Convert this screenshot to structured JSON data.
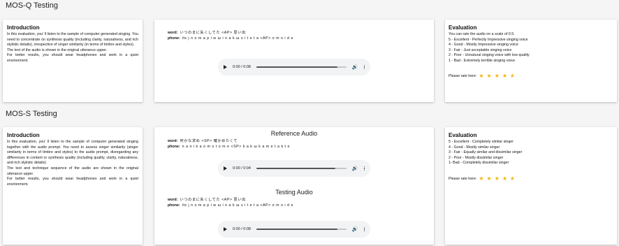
{
  "q": {
    "title": "MOS-Q Testing",
    "intro": {
      "heading": "Introduction",
      "lines": [
        "In this evaluation, you' ll listen to the sample of computer generated singing. You need to concentrate on synthesis quality (including clarity, naturalness, and rich stylistic details), irrespective of singer similarity (in terms of timbre and styles).",
        "The text of the audio is shown in the original utterance upper.",
        "For better results, you should wear headphones and work in a quiet environment."
      ]
    },
    "sample": {
      "word_label": "word:",
      "word": "いつのまに失くしてた <AP> 思い出",
      "phone_label": "phone:",
      "phone": "its i̥ n o m a p i w ɯ i n a k ɯ s i t e t a <AP> o m o i d e",
      "player": {
        "time": "0:00 / 0:08",
        "progress": 0.9
      }
    },
    "eval": {
      "heading": "Evaluation",
      "lines": [
        "You can rate the audio on a scale of 0.5.",
        "5 - Excellent - Perfectly Impressive singing voice",
        "4 - Good - Mostly Impressive singing voice",
        "3 - Fair - Just acceptable singing voice",
        "2 - Poor - Unnatural singing voice with low quality",
        "1 - Bad - Extremely terrible singing voice"
      ],
      "rate_label": "Please rate here:",
      "rating": 4.5
    }
  },
  "s": {
    "title": "MOS-S Testing",
    "intro": {
      "heading": "Introduction",
      "lines": [
        "In this evaluation, you' ll listen to the sample of computer generated singing together with the audio prompt. You need to assess singer similarity (singer similarity in terms of timbre and styles) to the audio prompt, disregarding any differences in content or synthesis quality (including quality, clarity, naturalness, and rich stylistic details)",
        "The text and technique sequence of the audio are shown in the original utterance upper.",
        "For better results, you should wear headphones and work in a quiet environment."
      ]
    },
    "reference": {
      "heading": "Reference Audio",
      "word_label": "word:",
      "word": "何かな求め <SP> 確かめたくて",
      "phone_label": "phone:",
      "phone": "n a n i k a o m o t o m e <SP> k a k ɯ k a m e t a k t e",
      "player": {
        "time": "0:00 / 0:04",
        "progress": 0.88
      }
    },
    "testing": {
      "heading": "Testing Audio",
      "word_label": "word:",
      "word": "いつのまに失くしてた <AP> 思い出",
      "phone_label": "phone:",
      "phone": "its i̥ n o m a p i w ɯ i n a k ɯ s i t e t a <AP> o m o i d e",
      "player": {
        "time": "0:00 / 0:08",
        "progress": 0.9
      }
    },
    "eval": {
      "heading": "Evaluation",
      "lines": [
        "5 - Excellent - Completely similar singer",
        "4 - Good - Mostly similar singer",
        "3 - Fair - Equally similar and dissimilar singer",
        "2 - Poor - Mostly dissimilar singer",
        "1- Bad - Completely dissimilar singer"
      ],
      "rate_label": "Please rate here:",
      "rating": 4.5
    }
  },
  "icons": {
    "play": "play-icon",
    "volume": "volume-icon",
    "more": "more-vertical-icon",
    "star": "star-icon"
  },
  "colors": {
    "star": "#f5b301",
    "card": "#ffffff",
    "background": "#f5f5f5",
    "player": "#f1f3f4"
  }
}
